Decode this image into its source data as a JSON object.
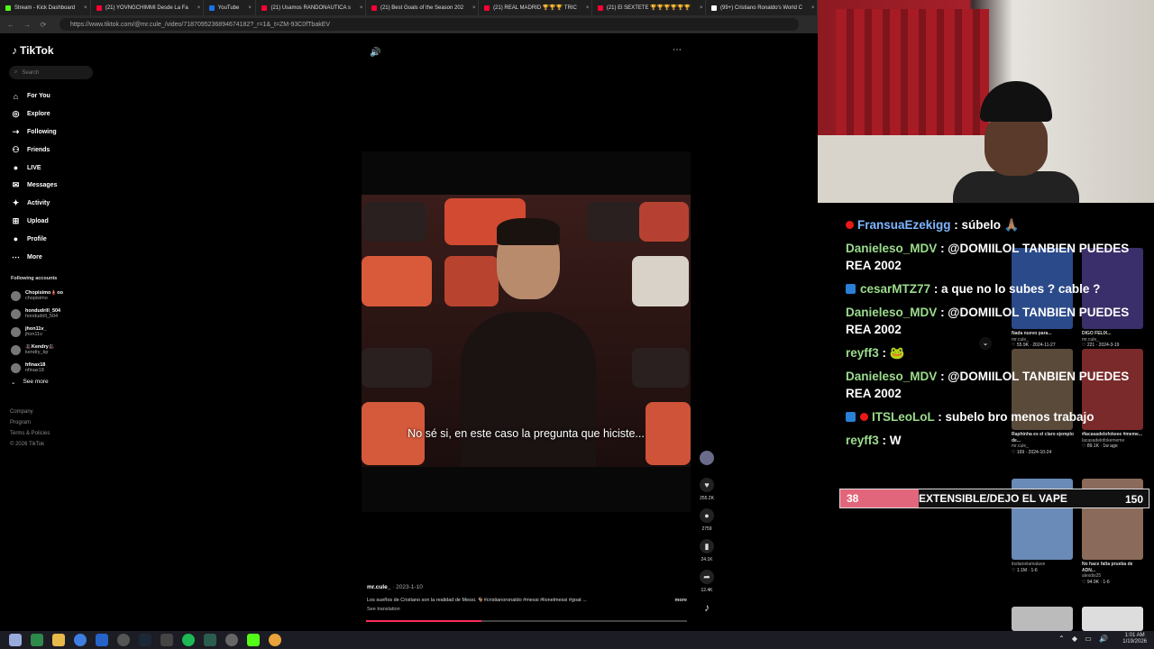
{
  "browser": {
    "tabs": [
      {
        "label": "Stream - Kick Dashboard",
        "color": "#53fc18"
      },
      {
        "label": "(21) YOVNGCHIMMI Desde La Fa",
        "color": "#ff0033"
      },
      {
        "label": "YouTube",
        "color": "#1a73e8"
      },
      {
        "label": "(21) Usamos RANDONAUTICA s",
        "color": "#ff0033"
      },
      {
        "label": "(21) Best Goals of the Season 202",
        "color": "#ff0033"
      },
      {
        "label": "(21) REAL MADRID 🏆🏆🏆 TRIC",
        "color": "#ff0033"
      },
      {
        "label": "(21) El SEXTETE 🏆🏆🏆🏆🏆🏆",
        "color": "#ff0033"
      },
      {
        "label": "(99+) Cristiano Ronaldo's World C",
        "color": "#ffffff"
      }
    ],
    "url": "https://www.tiktok.com/@mr.cule_/video/7187095236894674182?_r=1&_t=ZM-93C0fTbakEV"
  },
  "tiktok": {
    "logo": "TikTok",
    "search_placeholder": "Search",
    "menu": [
      {
        "label": "For You",
        "icon": "home-icon",
        "glyph": "⌂"
      },
      {
        "label": "Explore",
        "icon": "compass-icon",
        "glyph": "◎"
      },
      {
        "label": "Following",
        "icon": "following-icon",
        "glyph": "⇢"
      },
      {
        "label": "Friends",
        "icon": "friends-icon",
        "glyph": "⚇"
      },
      {
        "label": "LIVE",
        "icon": "live-icon",
        "glyph": "●"
      },
      {
        "label": "Messages",
        "icon": "messages-icon",
        "glyph": "✉"
      },
      {
        "label": "Activity",
        "icon": "activity-icon",
        "glyph": "✦"
      },
      {
        "label": "Upload",
        "icon": "upload-icon",
        "glyph": "⊞"
      },
      {
        "label": "Profile",
        "icon": "profile-icon",
        "glyph": "●"
      },
      {
        "label": "More",
        "icon": "more-icon",
        "glyph": "⋯"
      }
    ],
    "following_header": "Following accounts",
    "accounts": [
      {
        "name": "Chopisimo🧯oo",
        "handle": "chopisimo"
      },
      {
        "name": "hondudrill_504",
        "handle": "hondudrill_504"
      },
      {
        "name": "jhon11v_",
        "handle": "jhon11v"
      },
      {
        "name": "🎩Kendry🎩",
        "handle": "kendry_kp"
      },
      {
        "name": "hfinax18",
        "handle": "nfinax18"
      }
    ],
    "see_more": "See more",
    "footer": [
      "Company",
      "Program",
      "Terms & Policies",
      "© 2026 TikTok"
    ],
    "caption": "No sé si, en este caso la pregunta que hiciste...",
    "rail": {
      "likes": "255.2K",
      "comments": "2759",
      "saves": "24.1K",
      "shares": "12.4K"
    },
    "author": "mr.cule_",
    "date": "· 2023-1-10",
    "description": "Los sueños de Cristiano son la realidad de Messi. 🐐#cristianoronaldo #messi #lionelmessi #goat ...",
    "more": "more",
    "see_translation": "See translation",
    "progress": 0.36
  },
  "chat": [
    {
      "user": "FransuaEzekigg",
      "text": ": súbelo 🙏🏽",
      "style": "n2",
      "badges": [
        "red"
      ]
    },
    {
      "user": "Danieleso_MDV",
      "text": ": @DOMIILOL TANBIEN PUEDES REA 2002",
      "style": "n",
      "badges": []
    },
    {
      "user": "cesarMTZ77",
      "text": ": a que no lo subes ? cable ?",
      "style": "n",
      "badges": [
        "blue"
      ]
    },
    {
      "user": "Danieleso_MDV",
      "text": ": @DOMIILOL TANBIEN PUEDES REA 2002",
      "style": "n",
      "badges": []
    },
    {
      "user": "reyff3",
      "text": ": 🐸",
      "style": "n",
      "badges": []
    },
    {
      "user": "Danieleso_MDV",
      "text": ": @DOMIILOL TANBIEN PUEDES REA 2002",
      "style": "n",
      "badges": []
    },
    {
      "user": "ITSLeoLoL",
      "text": ": subelo bro menos trabajo",
      "style": "n",
      "badges": [
        "blue",
        "red"
      ]
    },
    {
      "user": "reyff3",
      "text": ": W",
      "style": "n",
      "badges": []
    }
  ],
  "goal": {
    "current": "38",
    "label": "EXTENSIBLE/DEJO EL VAPE",
    "target": "150",
    "fraction": 0.2533
  },
  "side_videos": [
    {
      "title": "Nada nuevo para...",
      "user": "mr.cule_",
      "views": "55.9K",
      "date": "2024-11-27"
    },
    {
      "title": "DIGO FELIX...",
      "user": "mr.cule_",
      "views": "221",
      "date": "2024-3-19"
    },
    {
      "title": "Raphinha es el claro ejemplo de...",
      "user": "mr.cule_",
      "views": "169",
      "date": "2024-10-24"
    },
    {
      "title": "#lacasadelofokeee #meme...",
      "user": "lacasadelofokememe",
      "views": "89.1K",
      "date": "1w ago"
    },
    {
      "title": "",
      "user": "itsdanielamalave",
      "views": "1.1M",
      "date": "1-6"
    },
    {
      "title": "No hace falta prueba de ADN...",
      "user": "alexdis25",
      "views": "94.9K",
      "date": "1-6"
    }
  ],
  "clock": {
    "time": "1:01 AM",
    "date": "1/19/2026"
  },
  "colors": {
    "tiktok_red": "#fe2c55",
    "kick_green": "#53fc18",
    "goal_fill": "#e2667b"
  }
}
